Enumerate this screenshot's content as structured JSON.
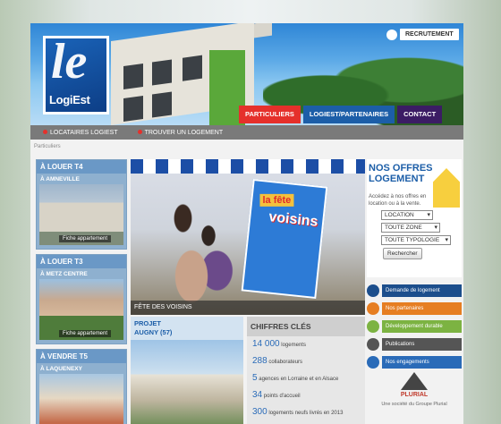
{
  "header": {
    "logo_text": "LogiEst",
    "logo_mark": "le",
    "recrutement": "RECRUTEMENT",
    "nav": [
      {
        "label": "PARTICULIERS",
        "color": "#e5302b"
      },
      {
        "label": "LOGIEST/PARTENAIRES",
        "color": "#1c5ea8"
      },
      {
        "label": "CONTACT",
        "color": "#3b1c64"
      }
    ]
  },
  "subnav": [
    "LOCATAIRES LOGIEST",
    "TROUVER UN LOGEMENT"
  ],
  "breadcrumb": "Particuliers",
  "left_cards": [
    {
      "title": "À LOUER T4",
      "location": "À AMNEVILLE",
      "fiche": "Fiche appartement"
    },
    {
      "title": "À LOUER T3",
      "location": "À METZ CENTRE",
      "fiche": "Fiche appartement"
    },
    {
      "title": "À VENDRE T5",
      "location": "À LAQUENEXY",
      "fiche": ""
    }
  ],
  "photo": {
    "caption": "FÊTE DES VOISINS",
    "poster_top": "la fête",
    "poster_main": "voisins"
  },
  "offres": {
    "title": "NOS OFFRES LOGEMENT",
    "text": "Accédez à nos offres en location ou à la vente.",
    "selects": [
      "LOCATION",
      "TOUTE ZONE",
      "TOUTE TYPOLOGIE"
    ],
    "button": "Rechercher"
  },
  "links": [
    {
      "label": "Demande de logement",
      "color": "#1c4e8c"
    },
    {
      "label": "Nos partenaires",
      "color": "#e67e22"
    },
    {
      "label": "Développement durable",
      "color": "#7cb342"
    },
    {
      "label": "Publications",
      "color": "#555555"
    },
    {
      "label": "Nos engagements",
      "color": "#2a6bb8"
    }
  ],
  "plurial": {
    "name": "PLURIAL",
    "text": "Une société du Groupe Plurial"
  },
  "projet": {
    "title": "PROJET",
    "subtitle": "AUGNY (57)"
  },
  "chiffres": {
    "title": "CHIFFRES CLÉS",
    "rows": [
      {
        "num": "14 000",
        "text": "logements"
      },
      {
        "num": "288",
        "text": "collaborateurs"
      },
      {
        "num": "5",
        "text": "agences en Lorraine et en Alsace"
      },
      {
        "num": "34",
        "text": "points d'accueil"
      },
      {
        "num": "300",
        "text": "logements neufs livrés en 2013"
      }
    ]
  }
}
